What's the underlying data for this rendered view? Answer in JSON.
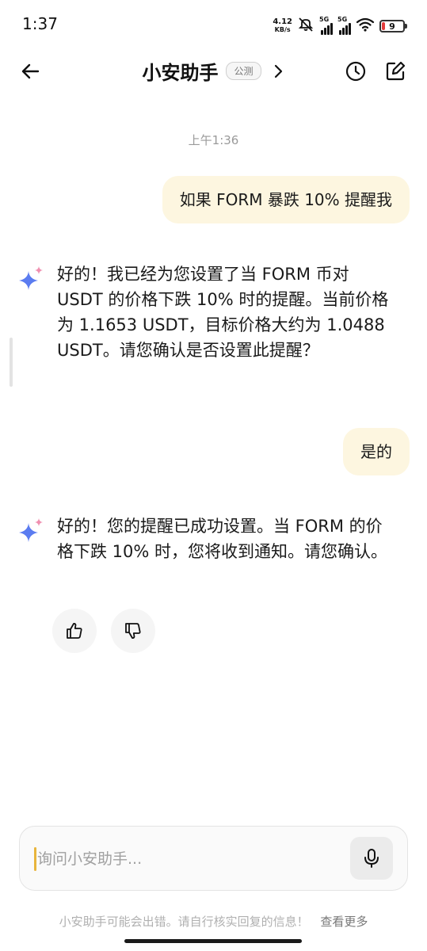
{
  "status_bar": {
    "time": "1:37",
    "net_speed_value": "4.12",
    "net_speed_unit": "KB/s",
    "sim1_tag": "5G",
    "sim2_tag": "5G",
    "battery_level": "9"
  },
  "header": {
    "title": "小安助手",
    "badge": "公测"
  },
  "chat": {
    "timestamp": "上午1:36",
    "messages": [
      {
        "role": "user",
        "text": "如果 FORM 暴跌 10% 提醒我"
      },
      {
        "role": "assistant",
        "text": "好的！我已经为您设置了当 FORM 币对 USDT 的价格下跌 10% 时的提醒。当前价格为 1.1653 USDT，目标价格大约为 1.0488 USDT。请您确认是否设置此提醒？"
      },
      {
        "role": "user",
        "text": "是的"
      },
      {
        "role": "assistant",
        "text": "好的！您的提醒已成功设置。当 FORM 的价格下跌 10% 时，您将收到通知。请您确认。"
      }
    ]
  },
  "input": {
    "placeholder": "询问小安助手..."
  },
  "footer": {
    "disclaimer": "小安助手可能会出错。请自行核实回复的信息！",
    "more_link": "查看更多"
  },
  "icons": {
    "back": "arrow-left-icon",
    "history": "clock-icon",
    "edit": "edit-icon",
    "assistant": "sparkle-icon",
    "like": "thumbs-up-icon",
    "dislike": "thumbs-down-icon",
    "mic": "mic-icon"
  },
  "colors": {
    "user_bubble": "#fdf6e0",
    "caret": "#e8b53c",
    "sparkle_blue": "#5b7cf0",
    "sparkle_pink": "#f08fb0"
  }
}
